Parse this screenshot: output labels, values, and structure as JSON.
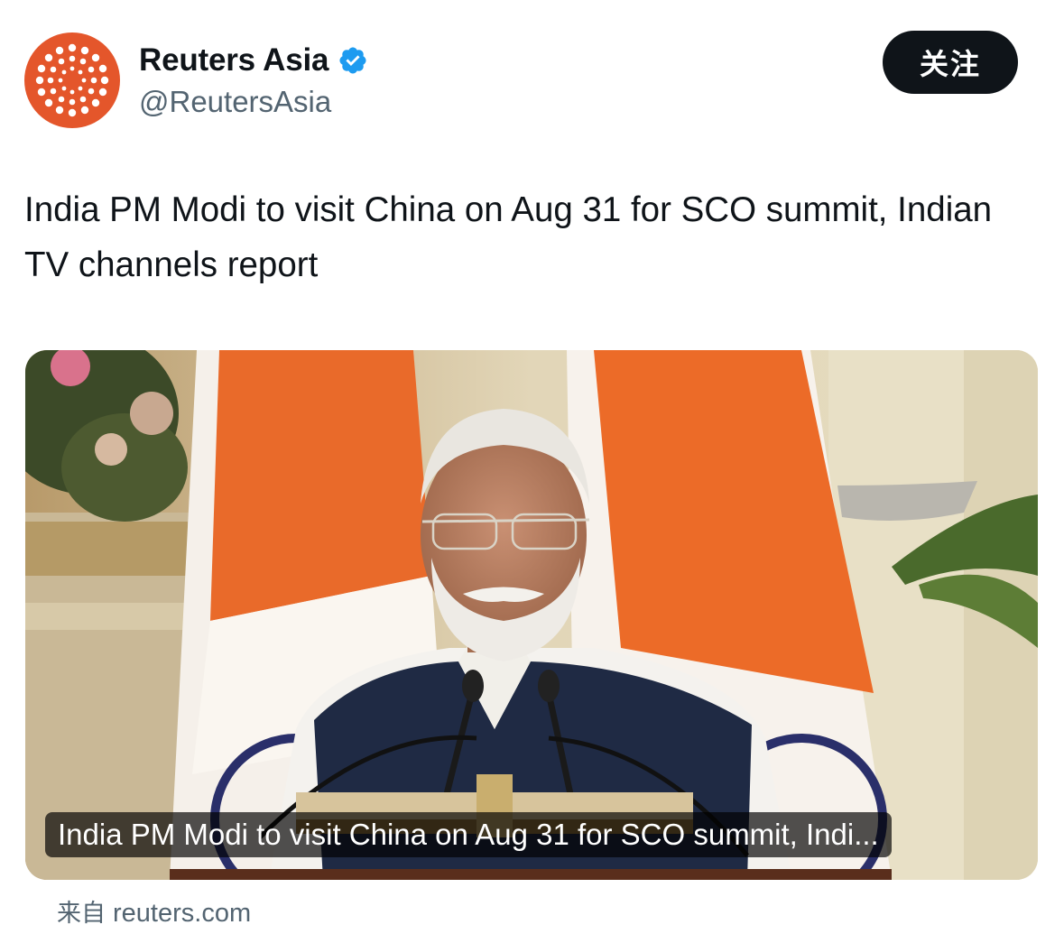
{
  "account": {
    "display_name": "Reuters Asia",
    "handle": "@ReutersAsia",
    "verified": true,
    "avatar_color": "#e4562b"
  },
  "follow_button": {
    "label": "关注"
  },
  "tweet": {
    "text": "India PM Modi to visit China on Aug 31 for SCO summit, Indian TV channels report"
  },
  "card": {
    "caption": "India PM Modi to visit China on Aug 31 for SCO summit, Indi..."
  },
  "source": {
    "prefix": "来自",
    "domain": "reuters.com"
  },
  "icons": {
    "verified": "verified-badge-icon",
    "avatar": "reuters-logo-icon"
  },
  "colors": {
    "text_primary": "#0f1419",
    "text_secondary": "#536471",
    "verified_blue": "#1d9bf0",
    "button_bg": "#0f1419"
  }
}
